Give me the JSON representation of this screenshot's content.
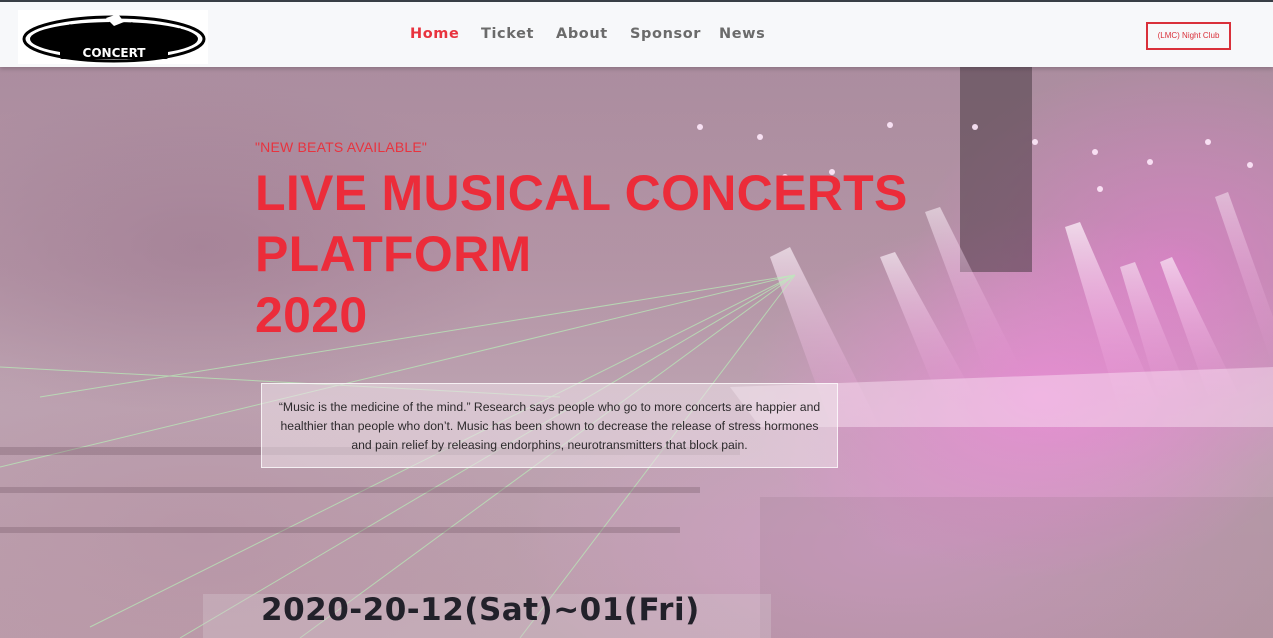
{
  "logo": {
    "text": "CONCERT",
    "icon": "concert-logo-icon"
  },
  "nav": {
    "items": [
      {
        "label": "Home",
        "active": true
      },
      {
        "label": "Ticket",
        "active": false
      },
      {
        "label": "About",
        "active": false
      },
      {
        "label": "Sponsor",
        "active": false
      },
      {
        "label": "News",
        "active": false
      }
    ],
    "cta_label": "(LMC) Night Club"
  },
  "hero": {
    "tagline": "\"NEW BEATS AVAILABLE\"",
    "headline_lines": [
      "LIVE MUSICAL CONCERTS",
      "PLATFORM",
      "2020"
    ],
    "quote": "“Music is the medicine of the mind.” Research says people who go to more concerts are happier and healthier than people who don’t. Music has been shown to decrease the release of stress hormones and pain relief by releasing endorphins, neurotransmitters that block pain.",
    "date_range": "2020-20-12(Sat)~01(Fri)"
  },
  "colors": {
    "accent": "#e8333e",
    "nav_text": "#6b6b6b",
    "navbar_bg": "#f7f8fa",
    "date_text": "#22212a"
  }
}
